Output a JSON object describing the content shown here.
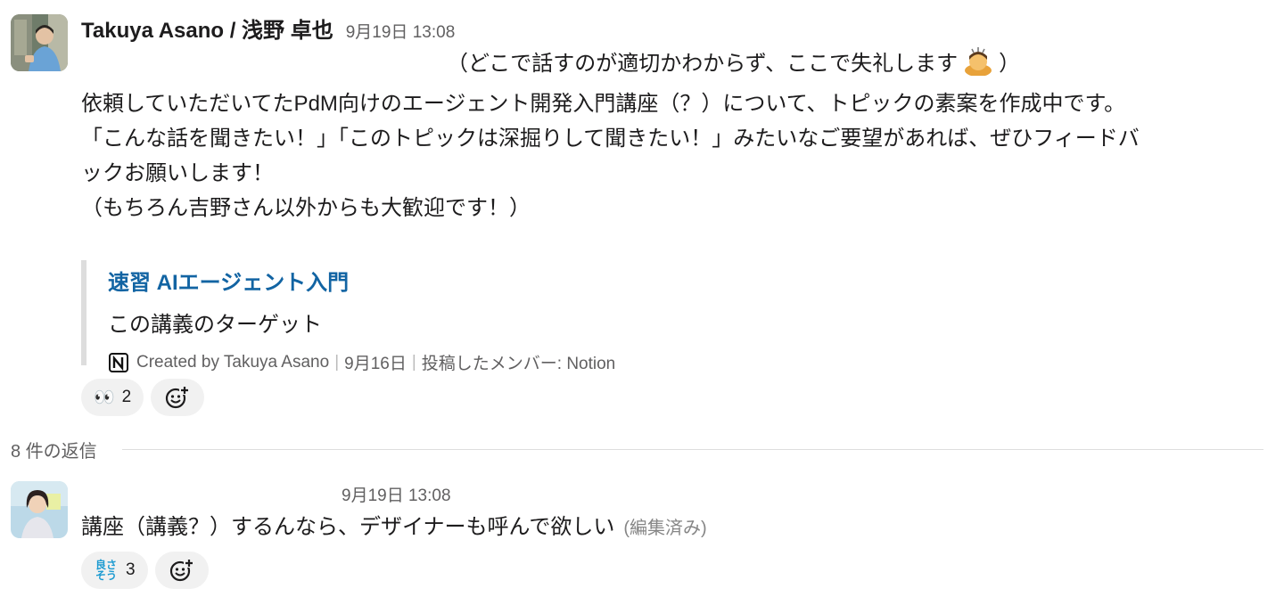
{
  "message": {
    "author": "Takuya Asano / 浅野 卓也",
    "timestamp": "9月19日 13:08",
    "lines": [
      "（どこで話すのが適切かわからず、ここで失礼します",
      "）",
      "依頼していただいてたPdM向けのエージェント開発入門講座（？）について、トピックの素案を作成中です。",
      "「こんな話を聞きたい！」「このトピックは深掘りして聞きたい！」みたいなご要望があれば、ぜひフィードバ",
      "ックお願いします！",
      "（もちろん吉野さん以外からも大歓迎です！）"
    ],
    "inline_emoji": "bowing-person-emoji",
    "unfurl": {
      "title": "速習 AIエージェント入門",
      "subtitle": "この講義のターゲット",
      "created_by": "Created by Takuya Asano",
      "date": "9月16日",
      "posted_by": "投稿したメンバー: Notion",
      "separator": "|",
      "icon": "notion-icon"
    },
    "reactions": [
      {
        "emoji": "👀",
        "count": "2"
      }
    ],
    "add_reaction_icon": "add-reaction-icon"
  },
  "thread": {
    "replies_label": "8 件の返信"
  },
  "reply": {
    "timestamp": "9月19日 13:08",
    "text": "講座（講義？）するんなら、デザイナーも呼んで欲しい",
    "edited": "(編集済み)",
    "reactions": [
      {
        "emoji_text": "良さそう",
        "emoji_lines": [
          "良さ",
          "そう"
        ],
        "count": "3"
      }
    ]
  },
  "colors": {
    "link": "#1264a3",
    "muted": "#616061",
    "pill_bg": "#f1f1f1",
    "quote_bar": "#dddddd"
  }
}
